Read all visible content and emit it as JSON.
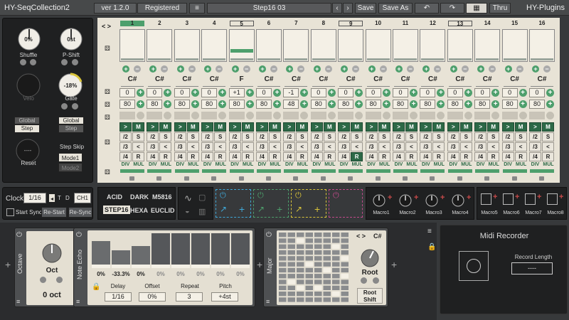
{
  "titlebar": {
    "app_name": "HY-SeqCollection2",
    "version": "ver 1.2.0",
    "registered": "Registered",
    "preset": "Step16 03",
    "save": "Save",
    "save_as": "Save As",
    "thru": "Thru",
    "brand": "HY-Plugins"
  },
  "left_panel": {
    "shuffle_value": "0%",
    "shuffle_label": "Shuffle",
    "pshift_value": "0st",
    "pshift_label": "P-Shift",
    "velo_label": "Velo",
    "gate_value": "-18%",
    "gate_label": "Gate",
    "velo_mode_top": "Global",
    "velo_mode_bottom": "Step",
    "gate_mode_top": "Global",
    "gate_mode_bottom": "Step",
    "reset_value": "----",
    "reset_label": "Reset",
    "step_skip_label": "Step Skip",
    "mode1": "Mode1",
    "mode2": "Mode2"
  },
  "grid": {
    "nav": "< >",
    "columns": [
      {
        "num": "1",
        "note": "C#",
        "oct": "0",
        "vel": "80",
        "bar": 0,
        "active": true
      },
      {
        "num": "2",
        "note": "C#",
        "oct": "0",
        "vel": "80",
        "bar": 0
      },
      {
        "num": "3",
        "note": "C#",
        "oct": "0",
        "vel": "80",
        "bar": 0
      },
      {
        "num": "4",
        "note": "C#",
        "oct": "0",
        "vel": "80",
        "bar": 0
      },
      {
        "num": "5",
        "note": "F",
        "oct": "+1",
        "vel": "80",
        "bar": 0.3,
        "boxed": true
      },
      {
        "num": "6",
        "note": "C#",
        "oct": "0",
        "vel": "80",
        "bar": 0
      },
      {
        "num": "7",
        "note": "C#",
        "oct": "-1",
        "vel": "48",
        "bar": 0
      },
      {
        "num": "8",
        "note": "C#",
        "oct": "0",
        "vel": "80",
        "bar": 0
      },
      {
        "num": "9",
        "note": "C#",
        "oct": "0",
        "vel": "80",
        "bar": 0,
        "boxed": true
      },
      {
        "num": "10",
        "note": "C#",
        "oct": "0",
        "vel": "80",
        "bar": 0
      },
      {
        "num": "11",
        "note": "C#",
        "oct": "0",
        "vel": "80",
        "bar": 0
      },
      {
        "num": "12",
        "note": "C#",
        "oct": "0",
        "vel": "80",
        "bar": 0
      },
      {
        "num": "13",
        "note": "C#",
        "oct": "0",
        "vel": "80",
        "bar": 0,
        "boxed": true
      },
      {
        "num": "14",
        "note": "C#",
        "oct": "0",
        "vel": "80",
        "bar": 0
      },
      {
        "num": "15",
        "note": "C#",
        "oct": "0",
        "vel": "80",
        "bar": 0
      },
      {
        "num": "16",
        "note": "C#",
        "oct": "0",
        "vel": "80",
        "bar": 0
      }
    ],
    "btn_play": ">",
    "btn_m": "M",
    "btn_s": "S",
    "btn_r": "R",
    "btn_lt": "<",
    "div_2": "/2",
    "div_3": "/3",
    "div_4": "/4",
    "div_label": "DIV",
    "mul_label": "MUL"
  },
  "clock": {
    "label": "Clock",
    "value": "1/16",
    "t": "T",
    "d": "D",
    "ch": "CH1",
    "start_sync": "Start Sync",
    "restart": "Re-Start",
    "resync": "Re-Sync"
  },
  "modes": {
    "m1": "ACID",
    "m2": "DARK",
    "m3": "M5816",
    "m4": "STEP16",
    "m5": "HEXA",
    "m6": "EUCLID"
  },
  "macros": [
    "Macro1",
    "Macro2",
    "Macro3",
    "Macro4",
    "Macro5",
    "Macro6",
    "Macro7",
    "Macro8"
  ],
  "octave_module": {
    "side_label": "Octave",
    "knob_label": "Oct",
    "value": "0 oct"
  },
  "note_echo": {
    "side_label": "Note Echo",
    "bars": [
      "0%",
      "-33.3%",
      "0%",
      "0%",
      "0%",
      "0%",
      "0%",
      "0%"
    ],
    "delay_label": "Delay",
    "delay_value": "1/16",
    "offset_label": "Offset",
    "offset_value": "0%",
    "repeat_label": "Repeat",
    "repeat_value": "3",
    "pitch_label": "Pitch",
    "pitch_value": "+4st"
  },
  "scale": {
    "side_label": "Major",
    "key": "C#",
    "nav": "< >",
    "root_label": "Root",
    "root_shift": "Root Shift"
  },
  "recorder": {
    "title": "Midi Recorder",
    "record_length_label": "Record Length",
    "record_length_value": "----"
  },
  "colors": {
    "accent": "#4d9f6c",
    "yellow": "#d9c43a",
    "cyan": "#3fa8d8",
    "magenta": "#c04a8a"
  }
}
